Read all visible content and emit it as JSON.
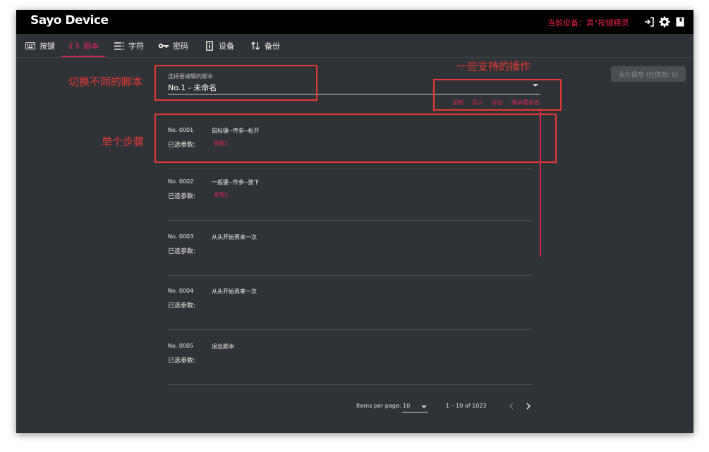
{
  "app": {
    "title": "Sayo Device",
    "device_label": "当前设备：真°按键精灵"
  },
  "nav": {
    "items": [
      {
        "label": "按键"
      },
      {
        "label": "脚本"
      },
      {
        "label": "字符"
      },
      {
        "label": "密码"
      },
      {
        "label": "设备"
      },
      {
        "label": "备份"
      }
    ],
    "active_index": 1
  },
  "script_select": {
    "label": "选择要编辑的脚本",
    "value": "No.1 - 未命名"
  },
  "actions": [
    "录制",
    "导入",
    "导出",
    "脚本重命名"
  ],
  "save_button": "永久保存 (已修改: 0)",
  "params_label": "已选参数:",
  "steps": [
    {
      "no": "No. 0001",
      "command": "鼠标键--传参--松开",
      "param": "参数1"
    },
    {
      "no": "No. 0002",
      "command": "一般键--传参--按下",
      "param": "参数1"
    },
    {
      "no": "No. 0003",
      "command": "从头开始再来一次",
      "param": ""
    },
    {
      "no": "No. 0004",
      "command": "从头开始再来一次",
      "param": ""
    },
    {
      "no": "No. 0005",
      "command": "退出脚本",
      "param": ""
    }
  ],
  "paginator": {
    "items_per_page_label": "Items per page:",
    "page_size": "10",
    "range": "1 – 10 of 1023"
  },
  "annotations": {
    "switch_script": "切换不同的脚本",
    "supported_ops": "一些支持的操作",
    "single_step": "单个步骤"
  },
  "colors": {
    "accent": "#d6245a",
    "background": "#2f3337",
    "titlebar": "#000000",
    "annotation": "#e53935"
  },
  "icons": {
    "titlebar": [
      "login-icon",
      "gear-icon",
      "book-icon"
    ],
    "nav": [
      "keyboard-icon",
      "code-icon",
      "text-list-icon",
      "key-icon",
      "device-icon",
      "swap-vert-icon"
    ]
  }
}
